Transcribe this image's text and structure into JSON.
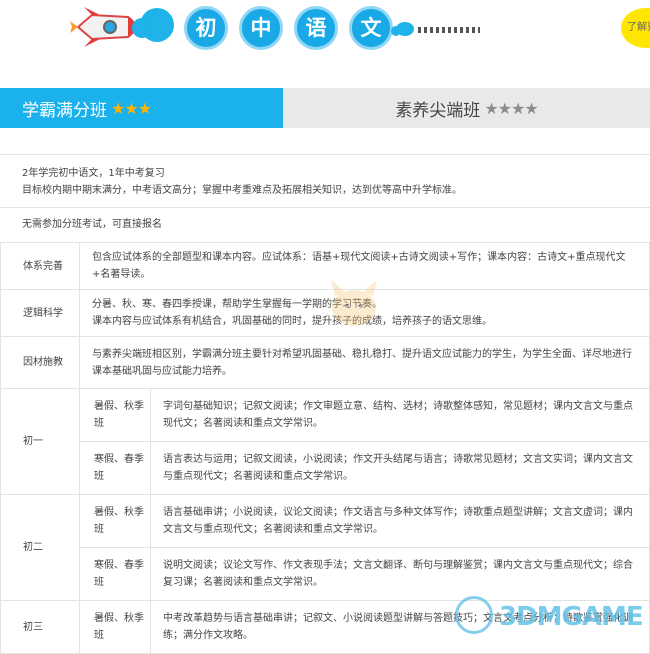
{
  "header": {
    "title_chars": [
      "初",
      "中",
      "语",
      "文"
    ],
    "learn_more": "了解更多"
  },
  "tabs": [
    {
      "label": "学霸满分班",
      "stars": "★★★",
      "active": true
    },
    {
      "label": "素养尖端班",
      "stars": "★★★★",
      "active": false
    }
  ],
  "intro": {
    "line1": "2年学完初中语文，1年中考复习",
    "line2": "目标校内期中期末满分，中考语文高分；掌握中考重难点及拓展相关知识，达到优等高中升学标准。",
    "admission": "无需参加分班考试，可直接报名"
  },
  "features": [
    {
      "name": "体系完善",
      "text": "包含应试体系的全部题型和课本内容。应试体系：语基+现代文阅读+古诗文阅读+写作；课本内容：古诗文+重点现代文+名著导读。"
    },
    {
      "name": "逻辑科学",
      "text": "分暑、秋、寒、春四季授课，帮助学生掌握每一学期的学习节奏。\n课本内容与应试体系有机结合，巩固基础的同时，提升孩子的成绩，培养孩子的语文思维。"
    },
    {
      "name": "因材施教",
      "text": "与素养尖端班相区别，学霸满分班主要针对希望巩固基础、稳扎稳打、提升语文应试能力的学生，为学生全面、详尽地进行课本基础巩固与应试能力培养。"
    }
  ],
  "grades": [
    {
      "name": "初一",
      "rows": [
        {
          "season": "暑假、秋季班",
          "detail": "字词句基础知识；记叙文阅读；作文审题立意、结构、选材；诗歌整体感知，常见题材；课内文言文与重点现代文；名著阅读和重点文学常识。"
        },
        {
          "season": "寒假、春季班",
          "detail": "语言表达与运用；记叙文阅读，小说阅读；作文开头结尾与语言；诗歌常见题材；文言文实词；课内文言文与重点现代文；名著阅读和重点文学常识。"
        }
      ]
    },
    {
      "name": "初二",
      "rows": [
        {
          "season": "暑假、秋季班",
          "detail": "语言基础串讲；小说阅读，议论文阅读；作文语言与多种文体写作；诗歌重点题型讲解；文言文虚词；课内文言文与重点现代文；名著阅读和重点文学常识。"
        },
        {
          "season": "寒假、春季班",
          "detail": "说明文阅读；议论文写作、作文表现手法；文言文翻译、断句与理解鉴赏；课内文言文与重点现代文；综合复习课；名著阅读和重点文学常识。"
        }
      ]
    },
    {
      "name": "初三",
      "rows": [
        {
          "season": "暑假、秋季班",
          "detail": "中考改革趋势与语言基础串讲；记叙文、小说阅读题型讲解与答题技巧；文言文考点分析；诗歌鉴赏强化训练；满分作文攻略。"
        }
      ]
    }
  ],
  "watermark": "3DMGAME"
}
